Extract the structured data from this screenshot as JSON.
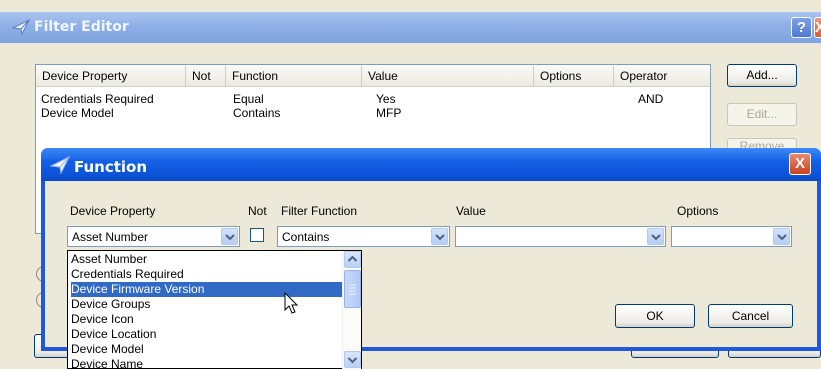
{
  "outer": {
    "title": "Filter Editor",
    "help_label": "?",
    "close_label": "X",
    "columns": [
      "Device Property",
      "Not",
      "Function",
      "Value",
      "Options",
      "Operator"
    ],
    "rows": [
      {
        "property": "Credentials Required",
        "not": "",
        "function": "Equal",
        "value": "Yes",
        "options": "",
        "operator": "AND"
      },
      {
        "property": "Device Model",
        "not": "",
        "function": "Contains",
        "value": "MFP",
        "options": "",
        "operator": ""
      }
    ],
    "buttons": {
      "add": "Add...",
      "edit": "Edit...",
      "remove": "Remove"
    }
  },
  "function_dialog": {
    "title": "Function",
    "close_label": "X",
    "labels": {
      "device_property": "Device Property",
      "not": "Not",
      "filter_function": "Filter Function",
      "value": "Value",
      "options": "Options"
    },
    "device_property_selected": "Asset Number",
    "not_checked": false,
    "filter_function_selected": "Contains",
    "value_selected": "",
    "options_selected": "",
    "dropdown_items": [
      "Asset Number",
      "Credentials Required",
      "Device Firmware Version",
      "Device Groups",
      "Device Icon",
      "Device Location",
      "Device Model",
      "Device Name"
    ],
    "dropdown_highlighted_index": 2,
    "buttons": {
      "ok": "OK",
      "cancel": "Cancel"
    }
  },
  "colors": {
    "xp_titlebar_blue": "#0b52d6",
    "xp_face": "#ece9d8",
    "selection_blue": "#316ac5",
    "close_red": "#dc5a38"
  }
}
